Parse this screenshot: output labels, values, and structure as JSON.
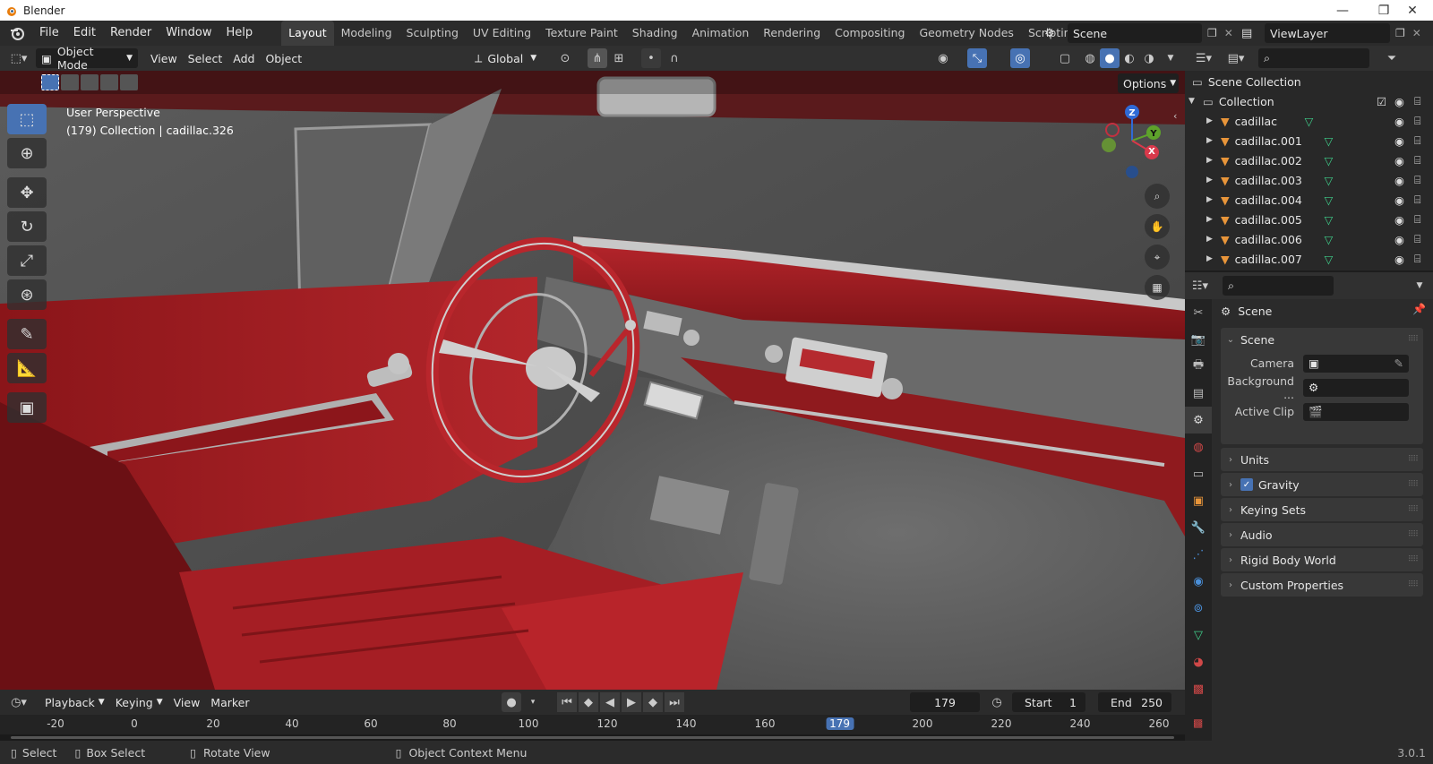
{
  "window": {
    "title": "Blender",
    "minimize": "—",
    "maximize": "❐",
    "close": "✕"
  },
  "menus": [
    "File",
    "Edit",
    "Render",
    "Window",
    "Help"
  ],
  "workspaces": [
    "Layout",
    "Modeling",
    "Sculpting",
    "UV Editing",
    "Texture Paint",
    "Shading",
    "Animation",
    "Rendering",
    "Compositing",
    "Geometry Nodes",
    "Scripting"
  ],
  "active_workspace": "Layout",
  "scene_field": "Scene",
  "viewlayer_field": "ViewLayer",
  "viewport_header": {
    "mode": "Object Mode",
    "menus": [
      "View",
      "Select",
      "Add",
      "Object"
    ],
    "orientation": "Global",
    "options": "Options"
  },
  "viewport": {
    "perspective": "User Perspective",
    "collection_info": "(179) Collection | cadillac.326",
    "gizmo": {
      "z": "Z",
      "y": "Y",
      "x": "X"
    }
  },
  "outliner": {
    "root": "Scene Collection",
    "collection": "Collection",
    "items": [
      "cadillac",
      "cadillac.001",
      "cadillac.002",
      "cadillac.003",
      "cadillac.004",
      "cadillac.005",
      "cadillac.006",
      "cadillac.007"
    ]
  },
  "properties": {
    "context": "Scene",
    "section": "Scene",
    "fields": {
      "camera": "Camera",
      "background": "Background ...",
      "active_clip": "Active Clip"
    },
    "panels": [
      "Units",
      "Gravity",
      "Keying Sets",
      "Audio",
      "Rigid Body World",
      "Custom Properties"
    ]
  },
  "timeline": {
    "menus": [
      "Playback",
      "Keying",
      "View",
      "Marker"
    ],
    "current_frame": "179",
    "start_label": "Start",
    "start": "1",
    "end_label": "End",
    "end": "250",
    "ticks": [
      "-20",
      "0",
      "20",
      "40",
      "60",
      "80",
      "100",
      "120",
      "140",
      "160",
      "179",
      "200",
      "220",
      "240",
      "260"
    ],
    "tick_values": [
      -20,
      0,
      20,
      40,
      60,
      80,
      100,
      120,
      140,
      160,
      179,
      200,
      220,
      240,
      260
    ]
  },
  "statusbar": {
    "select": "Select",
    "box_select": "Box Select",
    "rotate_view": "Rotate View",
    "context_menu": "Object Context Menu",
    "version": "3.0.1"
  },
  "colors": {
    "accent": "#4772b3",
    "mesh_orange": "#e8953a",
    "mesh_green": "#3fce8a",
    "upholstery": "#a31c22"
  }
}
